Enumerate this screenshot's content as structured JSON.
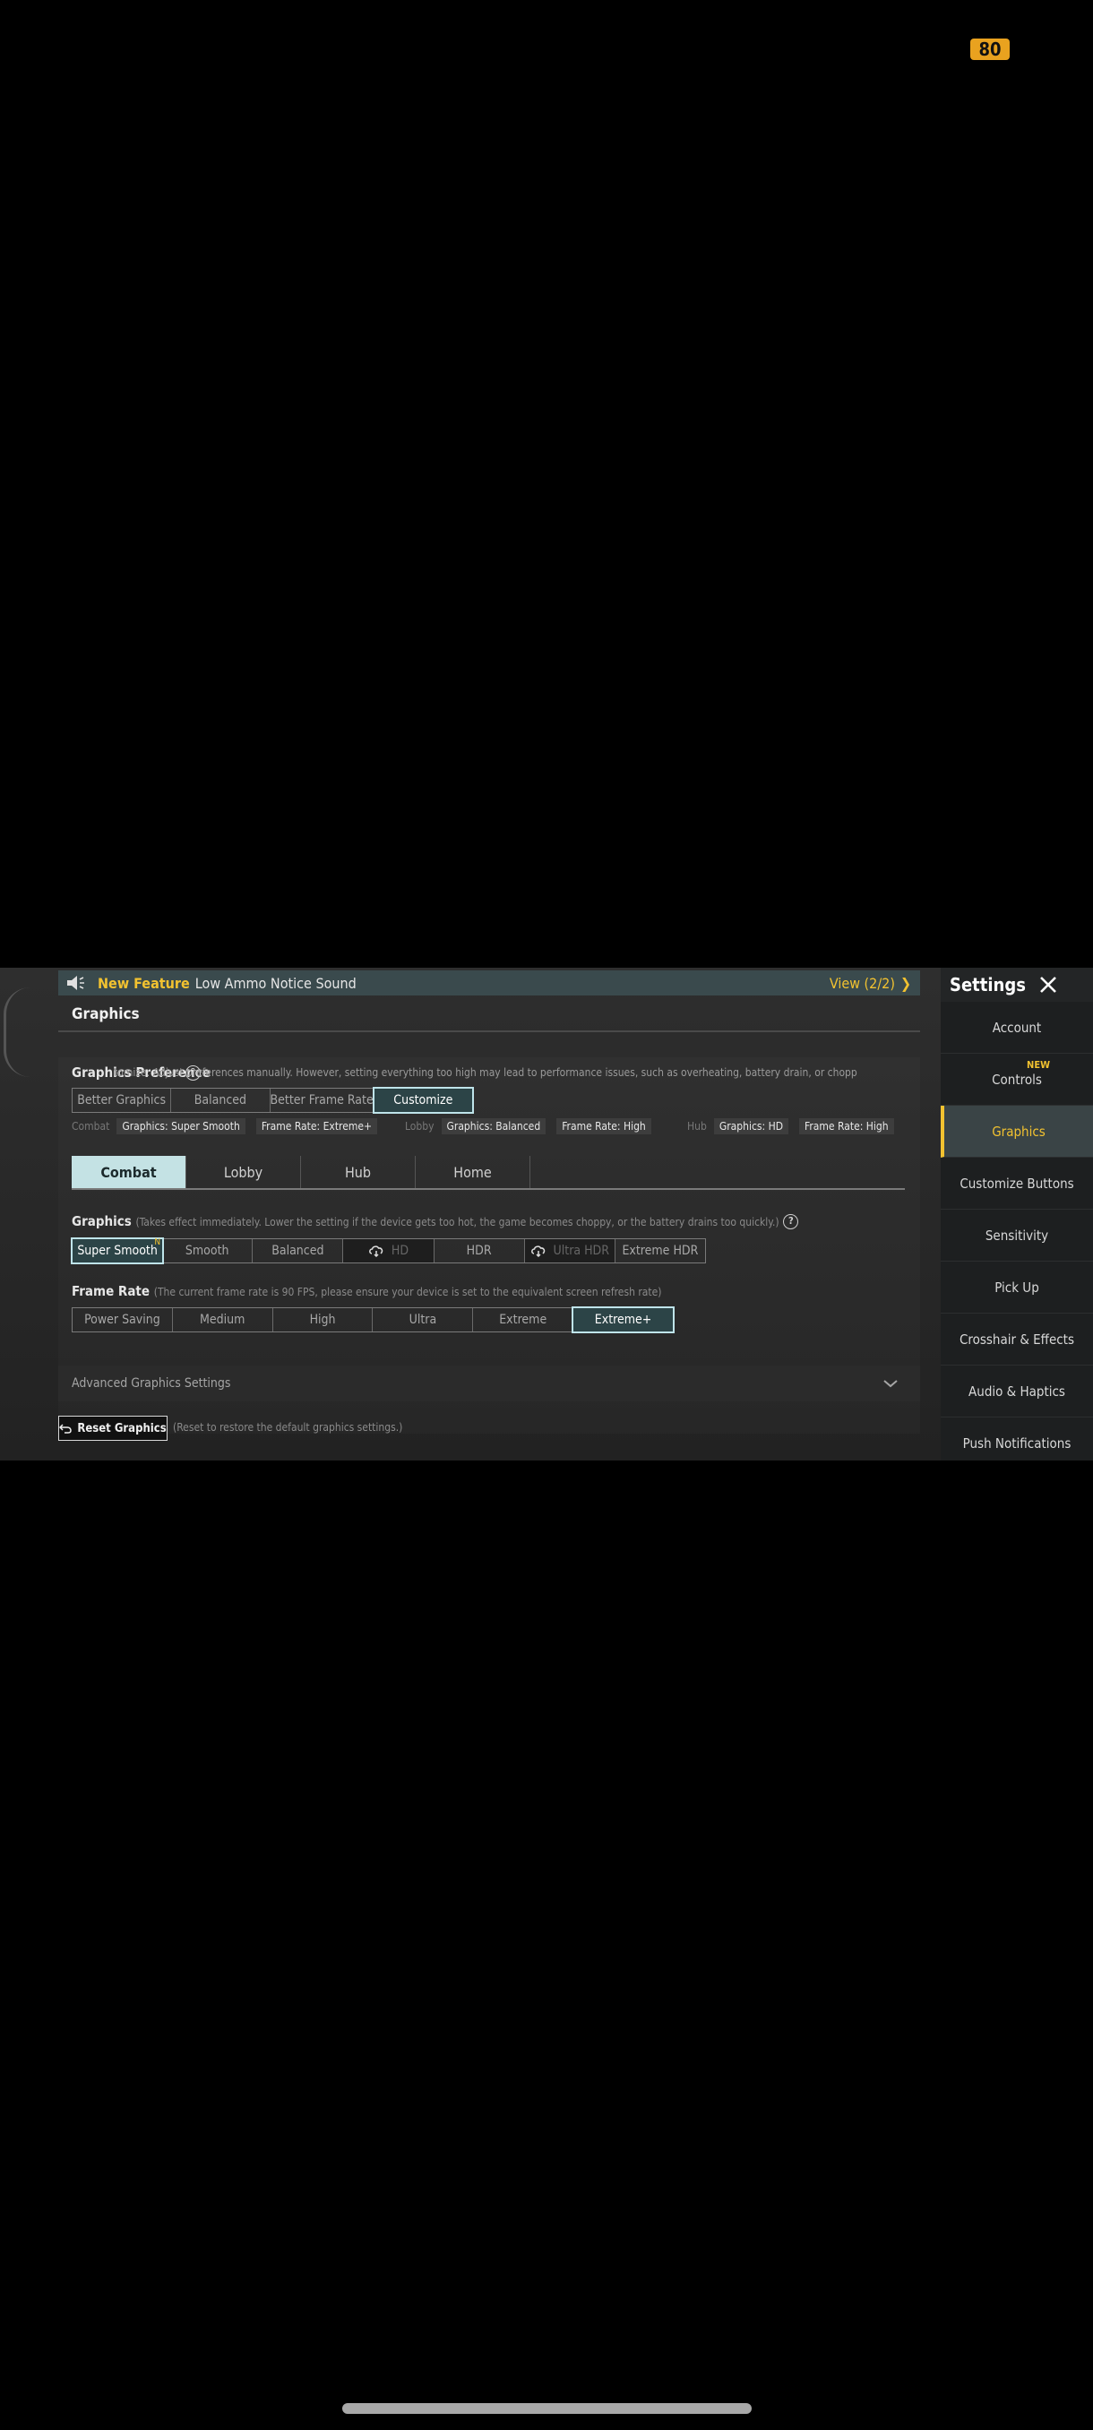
{
  "status": {
    "battery": "80"
  },
  "banner": {
    "new_label": "New Feature",
    "message": "Low Ammo Notice Sound",
    "view": "View (2/2)"
  },
  "page": {
    "title": "Graphics"
  },
  "preference": {
    "label": "Graphics Preference",
    "description": "tomize: Adjust preferences manually. However, setting everything too high may lead to performance issues, such as overheating, battery drain, or chopp",
    "options": [
      "Better Graphics",
      "Balanced",
      "Better Frame Rate",
      "Customize"
    ],
    "selected": "Customize"
  },
  "modes": {
    "combat": {
      "label": "Combat",
      "graphics": "Graphics: Super Smooth",
      "frame": "Frame Rate: Extreme+"
    },
    "lobby": {
      "label": "Lobby",
      "graphics": "Graphics: Balanced",
      "frame": "Frame Rate: High"
    },
    "hub": {
      "label": "Hub",
      "graphics": "Graphics: HD",
      "frame": "Frame Rate: High"
    }
  },
  "tabs": [
    "Combat",
    "Lobby",
    "Hub",
    "Home"
  ],
  "graphics": {
    "label": "Graphics",
    "hint": "(Takes effect immediately. Lower the setting if the device gets too hot, the game becomes choppy, or the battery drains too quickly.)",
    "options": [
      "Super Smooth",
      "Smooth",
      "Balanced",
      "HD",
      "HDR",
      "Ultra HDR",
      "Extreme HDR"
    ],
    "selected": "Super Smooth",
    "new_mark": "N"
  },
  "frame_rate": {
    "label": "Frame Rate",
    "hint": "(The current frame rate is 90 FPS, please ensure your device is set to the equivalent screen refresh rate)",
    "options": [
      "Power Saving",
      "Medium",
      "High",
      "Ultra",
      "Extreme",
      "Extreme+"
    ],
    "selected": "Extreme+"
  },
  "advanced": {
    "label": "Advanced Graphics Settings"
  },
  "reset": {
    "label": "Reset Graphics",
    "hint": "(Reset to restore the default graphics settings.)"
  },
  "sidebar": {
    "title": "Settings",
    "new_badge": "NEW",
    "items": [
      "Account",
      "Controls",
      "Graphics",
      "Customize Buttons",
      "Sensitivity",
      "Pick Up",
      "Crosshair & Effects",
      "Audio & Haptics",
      "Push Notifications"
    ]
  },
  "colors": {
    "accent": "#f2c230",
    "active_tab": "#c4e2e4",
    "selected_border": "#bfe4ea"
  }
}
